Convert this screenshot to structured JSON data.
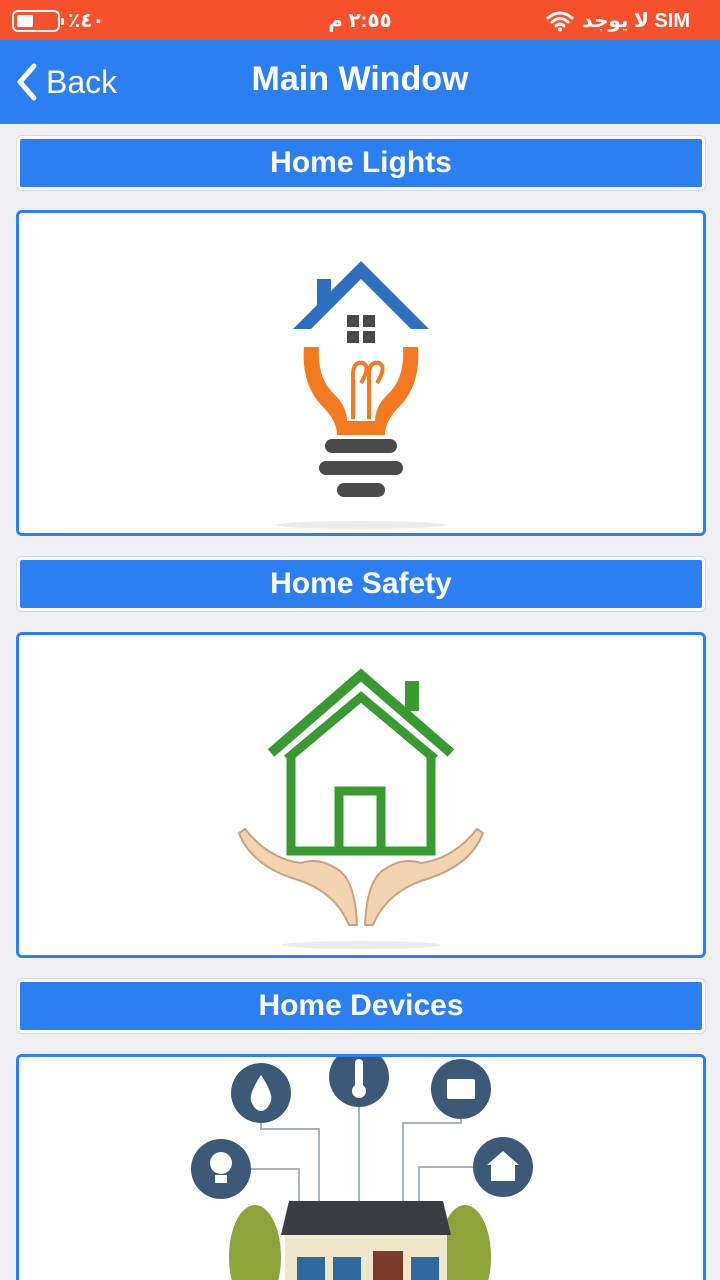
{
  "status_bar": {
    "battery": "٪٤٠",
    "time": "٢:٥٥ م",
    "carrier": "لا يوجد SIM"
  },
  "nav": {
    "back_label": "Back",
    "title": "Main Window"
  },
  "sections": [
    {
      "label": "Home Lights",
      "image_icon": "house-lightbulb-icon"
    },
    {
      "label": "Home Safety",
      "image_icon": "house-in-hands-icon"
    },
    {
      "label": "Home Devices",
      "image_icon": "smart-home-devices-icon"
    }
  ],
  "colors": {
    "status_bar": "#f4512c",
    "accent": "#2b7ff0",
    "background": "#efeff4"
  }
}
